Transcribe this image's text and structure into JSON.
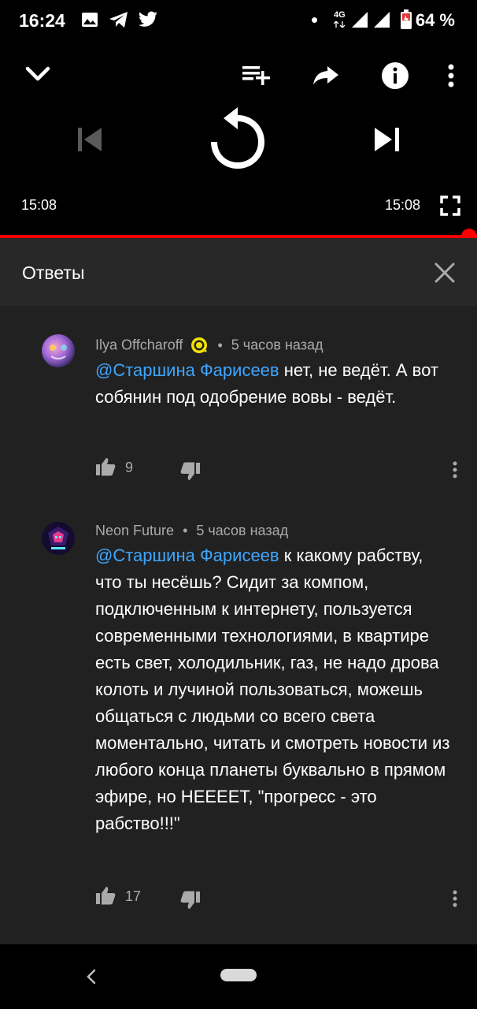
{
  "status_bar": {
    "time": "16:24",
    "network": "4G",
    "battery": "64 %"
  },
  "player": {
    "current_time": "15:08",
    "duration": "15:08",
    "progress": 1.0,
    "accent": "#ff0000"
  },
  "replies": {
    "title": "Ответы",
    "comments": [
      {
        "author": "Ilya Offcharoff",
        "separator": "•",
        "time": "5 часов назад",
        "mention": "@Старшина Фарисеев",
        "text": " нет, не ведёт. А вот собянин под одобрение вовы - ведёт.",
        "likes": "9"
      },
      {
        "author": "Neon Future",
        "separator": "•",
        "time": "5 часов назад",
        "mention": "@Старшина Фарисеев",
        "text": " к какому рабству, что ты несёшь? Сидит за компом, подключенным к интернету, пользуется современными технологиями, в квартире есть свет, холодильник, газ, не надо дрова колоть и лучиной пользоваться, можешь общаться с людьми со всего света моментально, читать и смотреть новости из любого конца планеты буквально в прямом эфире, но НЕЕЕЕТ, \"прогресс - это рабство!!!\"",
        "likes": "17"
      }
    ]
  },
  "colors": {
    "panel_bg": "#212121",
    "header_bg": "#282828",
    "mention": "#3ea6ff",
    "meta": "#aaaaaa"
  }
}
